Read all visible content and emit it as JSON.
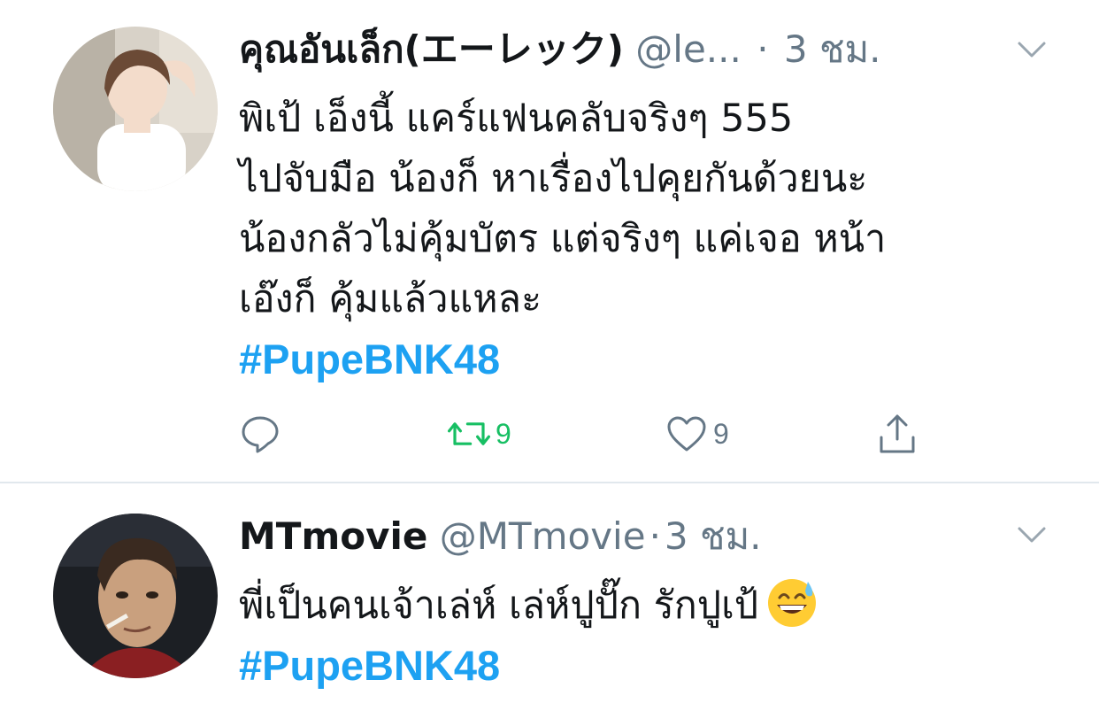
{
  "tweets": [
    {
      "name": "คุณอันเล็ก(エーレック)",
      "handle": "@le...",
      "separator": "·",
      "time": "3 ชม.",
      "text_lines": [
        "พิเป้ เอ็งนี้ แคร์แฟนคลับจริงๆ 555",
        "ไปจับมือ น้องก็ หาเรื่องไปคุยกันด้วยนะ",
        "น้องกลัวไม่คุ้มบัตร แต่จริงๆ แค่เจอ หน้า",
        "เอ๊งก็ คุ้มแล้วแหละ"
      ],
      "hashtag": "#PupeBNK48",
      "actions": {
        "reply_icon": "reply-icon",
        "retweet_icon": "retweet-icon",
        "retweet_count": "9",
        "like_icon": "heart-icon",
        "like_count": "9",
        "share_icon": "share-icon"
      }
    },
    {
      "name": "MTmovie",
      "handle": "@MTmovie",
      "separator": "·",
      "time": "3 ชม.",
      "text_lines": [
        "พี่เป็นคนเจ้าเล่ห์ เล่ห์ปูปั๊ก รักปูเป้"
      ],
      "emoji": "grinning-face-with-sweat-emoji",
      "hashtag": "#PupeBNK48"
    }
  ],
  "colors": {
    "link": "#1da1f2",
    "muted": "#657786",
    "retweet_active": "#17bf63",
    "divider": "#e1e8ed"
  }
}
